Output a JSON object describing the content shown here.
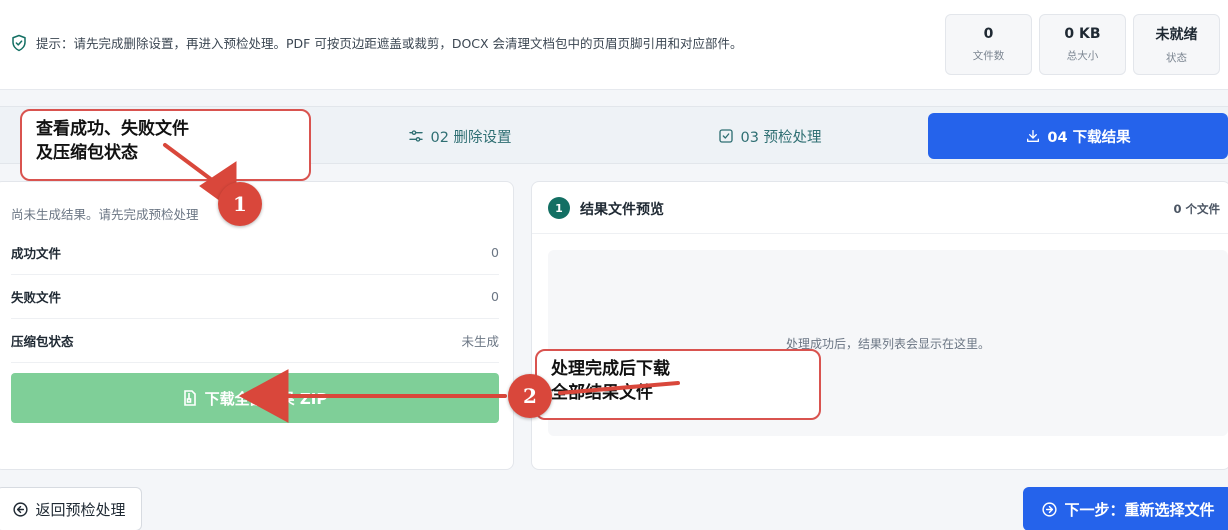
{
  "header": {
    "tip_text": "提示：请先完成删除设置，再进入预检处理。PDF 可按页边距遮盖或裁剪，DOCX 会清理文档包中的页眉页脚引用和对应部件。",
    "stats": [
      {
        "value": "0",
        "label": "文件数"
      },
      {
        "value": "0 KB",
        "label": "总大小"
      },
      {
        "value": "未就绪",
        "label": "状态"
      }
    ]
  },
  "steps": {
    "step2": "02 删除设置",
    "step3": "03 预检处理",
    "step4": "04 下载结果"
  },
  "left_panel": {
    "note": "尚未生成结果。请先完成预检处理",
    "rows": [
      {
        "label": "成功文件",
        "value": "0"
      },
      {
        "label": "失败文件",
        "value": "0"
      },
      {
        "label": "压缩包状态",
        "value": "未生成"
      }
    ],
    "download_button": "下载全部结果 ZIP"
  },
  "right_panel": {
    "badge": "1",
    "title": "结果文件预览",
    "count": "0 个文件",
    "empty_text": "处理成功后，结果列表会显示在这里。"
  },
  "footer": {
    "back_label": "返回预检处理",
    "next_label": "下一步：重新选择文件"
  },
  "annotations": {
    "callout1_line1": "查看成功、失败文件",
    "callout1_line2": "及压缩包状态",
    "callout2_line1": "处理完成后下载",
    "callout2_line2": "全部结果文件",
    "marker1": "1",
    "marker2": "2"
  },
  "colors": {
    "accent": "#2563eb",
    "teal": "#136f63",
    "download_green": "#7fcf98",
    "annotation_red": "#d9473b"
  }
}
